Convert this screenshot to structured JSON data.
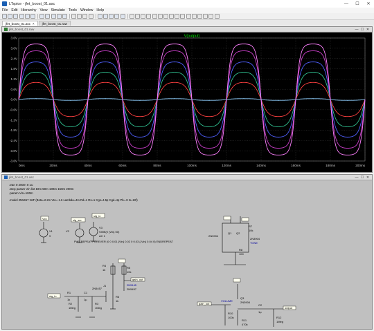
{
  "window": {
    "title": "LTspice - jfet_boost_01.asc",
    "minimize_glyph": "—",
    "maximize_glyph": "☐",
    "close_glyph": "✕"
  },
  "menu": [
    "File",
    "Edit",
    "Hierarchy",
    "View",
    "Simulate",
    "Tools",
    "Window",
    "Help"
  ],
  "tabs": [
    {
      "label": "jfet_boost_01.asc",
      "active": true
    },
    {
      "label": "jfet_boost_01.raw",
      "active": false
    }
  ],
  "tab_close_glyph": "×",
  "waveform_window": {
    "title": "jfet_boost_01.raw",
    "trace_label": "V(output)",
    "trace_color": "#00ff00"
  },
  "chart_data": {
    "type": "line",
    "title": "V(output)",
    "xlabel": "",
    "ylabel": "",
    "x_ticks": [
      "0ms",
      "20ms",
      "40ms",
      "60ms",
      "80ms",
      "100ms",
      "120ms",
      "140ms",
      "160ms",
      "180ms",
      "200ms"
    ],
    "y_ticks": [
      "3.6V",
      "3.0V",
      "2.4V",
      "1.8V",
      "1.2V",
      "0.6V",
      "0.0V",
      "-0.6V",
      "-1.2V",
      "-1.8V",
      "-2.4V",
      "-3.0V",
      "-3.6V"
    ],
    "xlim": [
      0,
      200
    ],
    "ylim": [
      -3.6,
      3.6
    ],
    "grid": true,
    "background": "#000000",
    "period_ms": 40,
    "series": [
      {
        "amplitude": 0.05,
        "color": "#8fd0ff"
      },
      {
        "amplitude": 1.0,
        "color": "#ff4040"
      },
      {
        "amplitude": 1.6,
        "color": "#30c090"
      },
      {
        "amplitude": 2.2,
        "color": "#5060ff"
      },
      {
        "amplitude": 2.85,
        "color": "#d040d0"
      },
      {
        "amplitude": 3.25,
        "color": "#ff80ff"
      }
    ]
  },
  "schematic_window": {
    "title": "jfet_boost_01.asc",
    "directives": [
      ".tran 0 200m 0 1u",
      ".step param Vin list 10m 50m 100m 150m 200m",
      ".param Vin=100m",
      ".model 2N5457 NJF (Beta=2.2m Vto=-1.6 Lambda=4m Rd=1 Rs=1 Cgs=4.5p Cgd=4p Pb=.8 Is=10f)",
      "PWL REPEAT FOREVER (0 0 0.01 {Vin} 0.02 0 0.03 {-Vin} 0.04 0) ENDREPEAT"
    ],
    "components": {
      "v1": "V1",
      "v1_val": "9",
      "v2": "V2",
      "v2_val": "SINE(0 {Vin} 50)",
      "v2_ac": "AC 1",
      "v3": "V3",
      "v3_val": "",
      "net_vcc": "Vcc",
      "net_sig_src": "sig_src",
      "net_sig_in": "sig_in",
      "net_gain_out": "gain_out",
      "net_output": "output",
      "net_vout": "vout",
      "r1": "R1",
      "r1_val": "1k",
      "c1": "C1",
      "c1_val": "1µ",
      "r2": "R2",
      "r2_val": "1Meg",
      "r3": "R3",
      "r3_val": "1Meg",
      "r4": "R4",
      "r4_val": "1k",
      "r5": "R5",
      "r5_val": "10k",
      "r6": "R6",
      "r6_val": "1k",
      "j1": "J1",
      "j1_model": "2N5457",
      "j2": "J2",
      "j2_model": "2N5457",
      "j2_note": "2N5145",
      "q1": "Q1",
      "q2": "Q2",
      "q_model": "2N3904",
      "q_model2": "2N3904",
      "q3": "Q3",
      "q3_model": "2N3904",
      "r7": "R7",
      "r7_val": "10k",
      "r8": "R8",
      "r8_val": "100",
      "r9": "R9",
      "r9_val": "100",
      "r10": "R10",
      "r10_val": "100k",
      "r11": "R11",
      "r11_val": "470k",
      "r12": "R12",
      "r12_val": "1Meg",
      "c2": "C2",
      "c2_val": "1µ",
      "vol_label": "VOLUME",
      "tone_label": "TONE"
    }
  }
}
